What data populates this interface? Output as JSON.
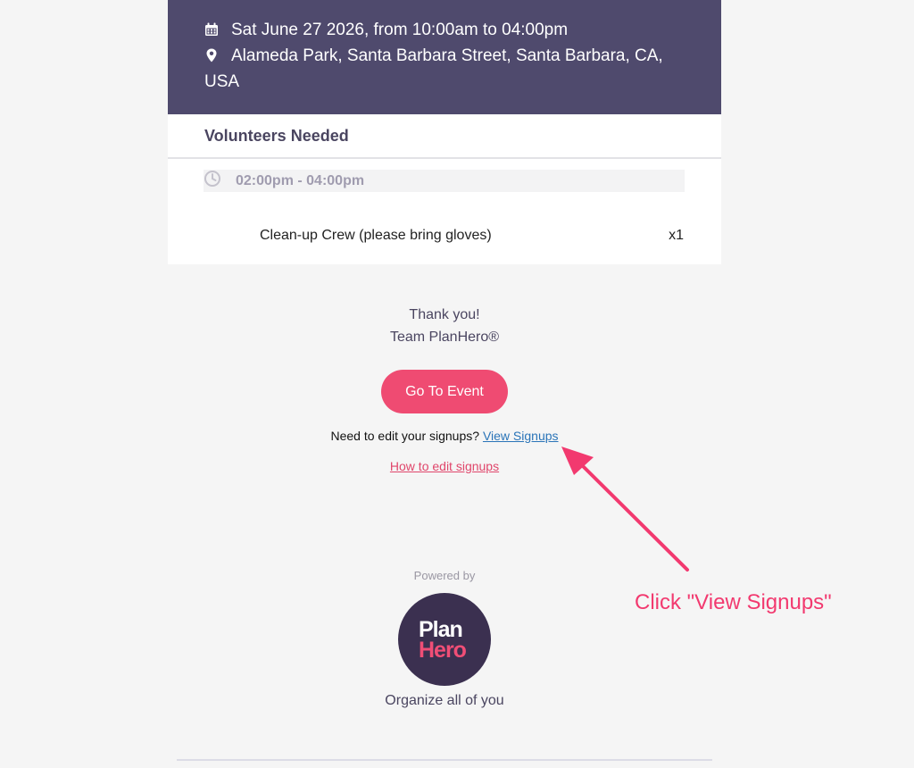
{
  "event": {
    "date_line": "Sat June 27 2026, from 10:00am to 04:00pm",
    "location_line1": "Alameda Park, Santa Barbara Street, Santa Barbara, CA,",
    "location_line2": "USA",
    "calendar_icon": "calendar-icon",
    "location_icon": "map-pin-icon"
  },
  "volunteers": {
    "title": "Volunteers Needed",
    "slot": {
      "icon": "clock-icon",
      "time": "02:00pm - 04:00pm",
      "roles": [
        {
          "name": "Clean-up Crew (please bring gloves)",
          "qty": "x1"
        }
      ]
    }
  },
  "footer": {
    "thanks_line1": "Thank you!",
    "thanks_line2": "Team PlanHero®",
    "cta_label": "Go To Event",
    "edit_prompt": "Need to edit your signups?",
    "edit_link": "View Signups",
    "howto_link": "How to edit signups",
    "powered_by": "Powered by",
    "logo_line1": "Plan",
    "logo_line2": "Hero",
    "tagline": "Organize all of you"
  },
  "annotation": {
    "callout": "Click \"View Signups\""
  },
  "colors": {
    "header_bg": "#4f4a6d",
    "accent_pink": "#ef4b72",
    "link_blue": "#2a74b8",
    "logo_bg": "#3b3050"
  }
}
